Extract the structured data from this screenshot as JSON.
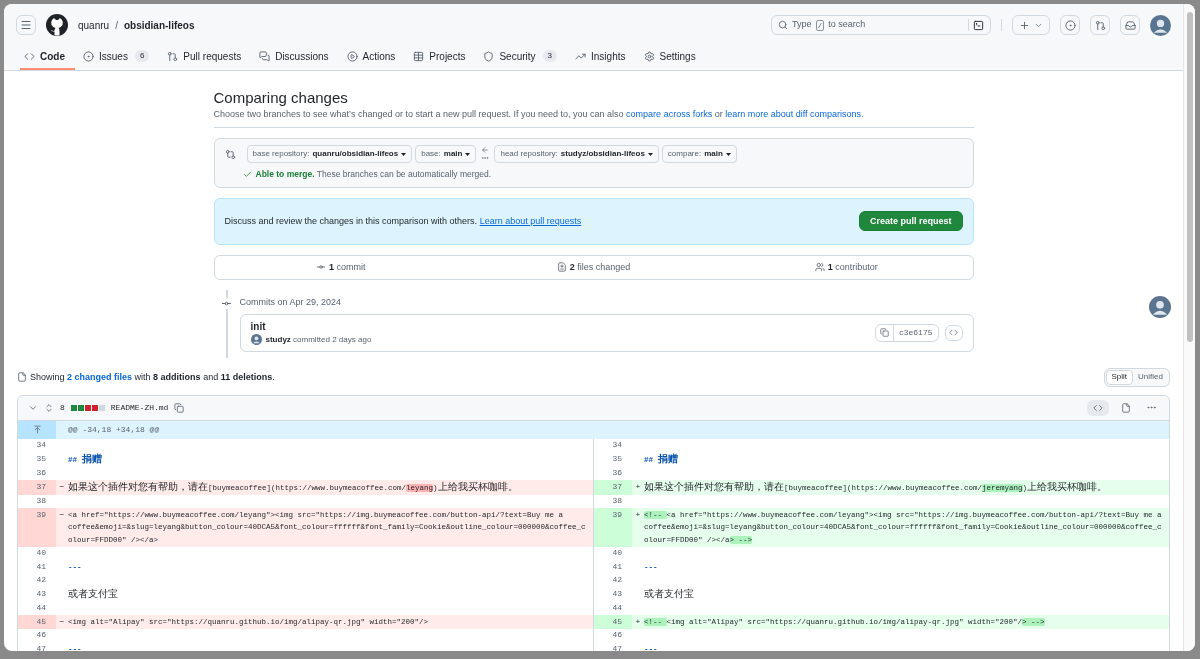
{
  "header": {
    "owner": "quanru",
    "separator": "/",
    "repo": "obsidian-lifeos",
    "search": {
      "placeholder": "Type",
      "key": "/",
      "placeholder_end": "to search"
    }
  },
  "tabs": [
    {
      "label": "Code",
      "selected": true
    },
    {
      "label": "Issues",
      "count": "6",
      "selected": false
    },
    {
      "label": "Pull requests",
      "selected": false
    },
    {
      "label": "Discussions",
      "selected": false
    },
    {
      "label": "Actions",
      "selected": false
    },
    {
      "label": "Projects",
      "selected": false
    },
    {
      "label": "Security",
      "count": "3",
      "selected": false
    },
    {
      "label": "Insights",
      "selected": false
    },
    {
      "label": "Settings",
      "selected": false
    }
  ],
  "compare": {
    "title": "Comparing changes",
    "description": "Choose two branches to see what’s changed or to start a new pull request. If you need to, you can also",
    "link_1": "compare across forks",
    "connector": "or",
    "link_2": "learn more about diff comparisons",
    "end": ".",
    "selectors": [
      {
        "label": "base repository:",
        "value": "quanru/obsidian-lifeos"
      },
      {
        "label": "base:",
        "value": "main"
      },
      {
        "label": "head repository:",
        "value": "studyz/obsidian-lifeos"
      },
      {
        "label": "compare:",
        "value": "main"
      }
    ],
    "merge_status": "Able to merge.",
    "merge_message": "These branches can be automatically merged."
  },
  "banner": {
    "text": "Discuss and review the changes in this comparison with others.",
    "link": "Learn about pull requests",
    "button": "Create pull request"
  },
  "stats": [
    {
      "count": "1",
      "label": "commit"
    },
    {
      "count": "2",
      "label": "files changed"
    },
    {
      "count": "1",
      "label": "contributor"
    }
  ],
  "commits": {
    "date_label": "Commits on Apr 29, 2024",
    "items": [
      {
        "title": "init",
        "author": "studyz",
        "meta": "committed 2 days ago",
        "sha": "c3e6175"
      }
    ]
  },
  "summary": {
    "before": "Showing",
    "link": "2 changed files",
    "after": "with **8 additions** and **11 deletions**."
  },
  "view_toggle": [
    {
      "label": "Split",
      "selected": true
    },
    {
      "label": "Unified",
      "selected": false
    }
  ],
  "file": {
    "expanded": true,
    "changes": "8",
    "diffstat": [
      {
        "color": "#1f883d"
      },
      {
        "color": "#1f883d"
      },
      {
        "color": "#cf222e"
      },
      {
        "color": "#cf222e"
      },
      {
        "color": "#d1d9e0"
      }
    ],
    "name": "README-ZH.md",
    "hunk": "@@ -34,18 +34,18 @@",
    "rows": [
      {
        "left": {
          "num": "34",
          "kind": "context"
        },
        "right": {
          "num": "34",
          "kind": "context"
        }
      },
      {
        "left": {
          "num": "35",
          "kind": "heading",
          "text": "## 捐赠"
        },
        "right": {
          "num": "35",
          "kind": "heading",
          "text": "## 捐赠"
        }
      },
      {
        "left": {
          "num": "36",
          "kind": "context"
        },
        "right": {
          "num": "36",
          "kind": "context"
        }
      },
      {
        "left": {
          "num": "37",
          "kind": "deleted",
          "sign": "−",
          "segments": [
            {
              "text": "如果这个插件对您有帮助，请在[buymeacoffee](https://www.buymeacoffee.com/",
              "highlighted": false
            },
            {
              "text": "leyang",
              "highlighted": true
            },
            {
              "text": ")上给我买杯咖啡。",
              "highlighted": false
            }
          ]
        },
        "right": {
          "num": "37",
          "kind": "added",
          "sign": "+",
          "segments": [
            {
              "text": "如果这个插件对您有帮助，请在[buymeacoffee](https://www.buymeacoffee.com/",
              "highlighted": false
            },
            {
              "text": "jeremyang",
              "highlighted": true
            },
            {
              "text": ")上给我买杯咖啡。",
              "highlighted": false
            }
          ]
        }
      },
      {
        "left": {
          "num": "38",
          "kind": "context"
        },
        "right": {
          "num": "38",
          "kind": "context"
        }
      },
      {
        "left": {
          "num": "39",
          "kind": "deleted",
          "sign": "−",
          "text": "<a href=\"https://www.buymeacoffee.com/leyang\"><img src=\"https://img.buymeacoffee.com/button-api/?text=Buy me a coffee&emoji=&slug=leyang&button_colour=40DCA5&font_colour=ffffff&font_family=Cookie&outline_colour=000000&coffee_colour=FFDD00\" /></a>"
        },
        "right": {
          "num": "39",
          "kind": "added",
          "sign": "+",
          "segments": [
            {
              "text": "<!-- ",
              "highlighted": true
            },
            {
              "text": "<a href=\"https://www.buymeacoffee.com/leyang\"><img src=\"https://img.buymeacoffee.com/button-api/?text=Buy me a coffee&emoji=&slug=leyang&button_colour=40DCA5&font_colour=ffffff&font_family=Cookie&outline_colour=000000&coffee_colour=FFDD00\" /></a",
              "highlighted": false
            },
            {
              "text": "> -->",
              "highlighted": true
            }
          ]
        }
      },
      {
        "left": {
          "num": "40",
          "kind": "context"
        },
        "right": {
          "num": "40",
          "kind": "context"
        }
      },
      {
        "left": {
          "num": "41",
          "kind": "heading",
          "text": "---"
        },
        "right": {
          "num": "41",
          "kind": "heading",
          "text": "---"
        }
      },
      {
        "left": {
          "num": "42",
          "kind": "context"
        },
        "right": {
          "num": "42",
          "kind": "context"
        }
      },
      {
        "left": {
          "num": "43",
          "kind": "context",
          "text": "或者支付宝"
        },
        "right": {
          "num": "43",
          "kind": "context",
          "text": "或者支付宝"
        }
      },
      {
        "left": {
          "num": "44",
          "kind": "context"
        },
        "right": {
          "num": "44",
          "kind": "context"
        }
      },
      {
        "left": {
          "num": "45",
          "kind": "deleted",
          "sign": "−",
          "text": "<img alt=\"Alipay\" src=\"https://quanru.github.io/img/alipay-qr.jpg\" width=\"200\"/>"
        },
        "right": {
          "num": "45",
          "kind": "added",
          "sign": "+",
          "segments": [
            {
              "text": "<!-- ",
              "highlighted": true
            },
            {
              "text": "<img alt=\"Alipay\" src=\"https://quanru.github.io/img/alipay-qr.jpg\" width=\"200\"/",
              "highlighted": false
            },
            {
              "text": "> -->",
              "highlighted": true
            }
          ]
        }
      },
      {
        "left": {
          "num": "46",
          "kind": "context"
        },
        "right": {
          "num": "46",
          "kind": "context"
        }
      },
      {
        "left": {
          "num": "47",
          "kind": "heading",
          "text": "---"
        },
        "right": {
          "num": "47",
          "kind": "heading",
          "text": "---"
        }
      }
    ]
  }
}
